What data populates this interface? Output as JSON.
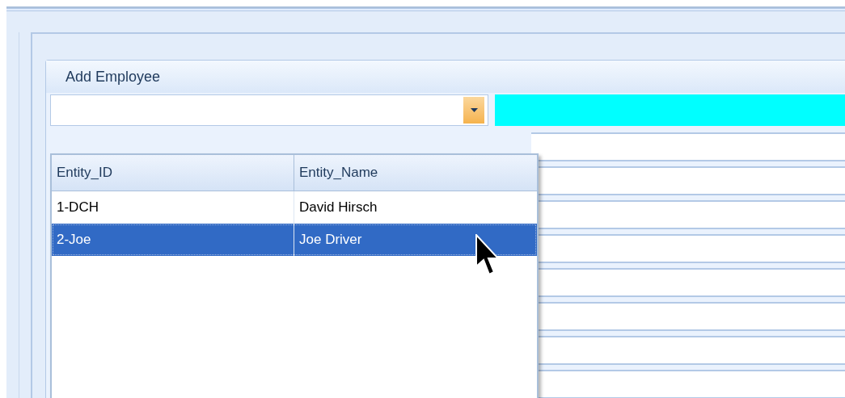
{
  "group": {
    "title": "Add Employee"
  },
  "dropdown": {
    "open": true,
    "columns": [
      "Entity_ID",
      "Entity_Name"
    ],
    "rows": [
      {
        "cells": [
          "1-DCH",
          "David Hirsch"
        ],
        "selected": false
      },
      {
        "cells": [
          "2-Joe",
          "Joe Driver"
        ],
        "selected": true
      }
    ]
  }
}
